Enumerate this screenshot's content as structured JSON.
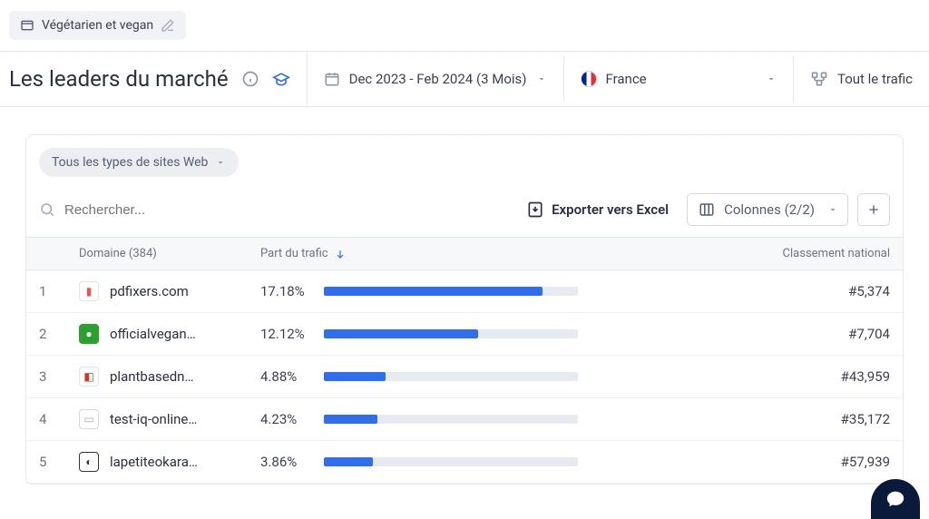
{
  "tag": {
    "label": "Végétarien et vegan"
  },
  "filters": {
    "title": "Les leaders du marché",
    "date_range": "Dec 2023 - Feb 2024 (3 Mois)",
    "region": "France",
    "traffic_scope": "Tout le trafic"
  },
  "panel": {
    "site_type_label": "Tous les types de sites Web",
    "search_placeholder": "Rechercher...",
    "export_label": "Exporter vers Excel",
    "columns_label": "Colonnes (2/2)"
  },
  "table": {
    "headers": {
      "domain": "Domaine (384)",
      "share": "Part du trafic",
      "rank": "Classement national"
    },
    "rows": [
      {
        "idx": "1",
        "domain": "pdfixers.com",
        "share_pct": "17.18%",
        "share_val": 17.18,
        "rank": "#5,374",
        "fav_bg": "#fff",
        "fav_border": "#e0e3ea",
        "fav_glyph": "▮",
        "fav_color": "#e8535a"
      },
      {
        "idx": "2",
        "domain": "officialvegan…",
        "share_pct": "12.12%",
        "share_val": 12.12,
        "rank": "#7,704",
        "fav_bg": "#2ca02c",
        "fav_border": "#2ca02c",
        "fav_glyph": "●",
        "fav_color": "#fff"
      },
      {
        "idx": "3",
        "domain": "plantbasedn…",
        "share_pct": "4.88%",
        "share_val": 4.88,
        "rank": "#43,959",
        "fav_bg": "#fff",
        "fav_border": "#e0e3ea",
        "fav_glyph": "◧",
        "fav_color": "#d93025"
      },
      {
        "idx": "4",
        "domain": "test-iq-online…",
        "share_pct": "4.23%",
        "share_val": 4.23,
        "rank": "#35,172",
        "fav_bg": "#fff",
        "fav_border": "#d4d8e0",
        "fav_glyph": "▭",
        "fav_color": "#a2a9b9"
      },
      {
        "idx": "5",
        "domain": "lapetiteokara…",
        "share_pct": "3.86%",
        "share_val": 3.86,
        "rank": "#57,939",
        "fav_bg": "#fff",
        "fav_border": "#333",
        "fav_glyph": "◐",
        "fav_color": "#333"
      }
    ]
  }
}
